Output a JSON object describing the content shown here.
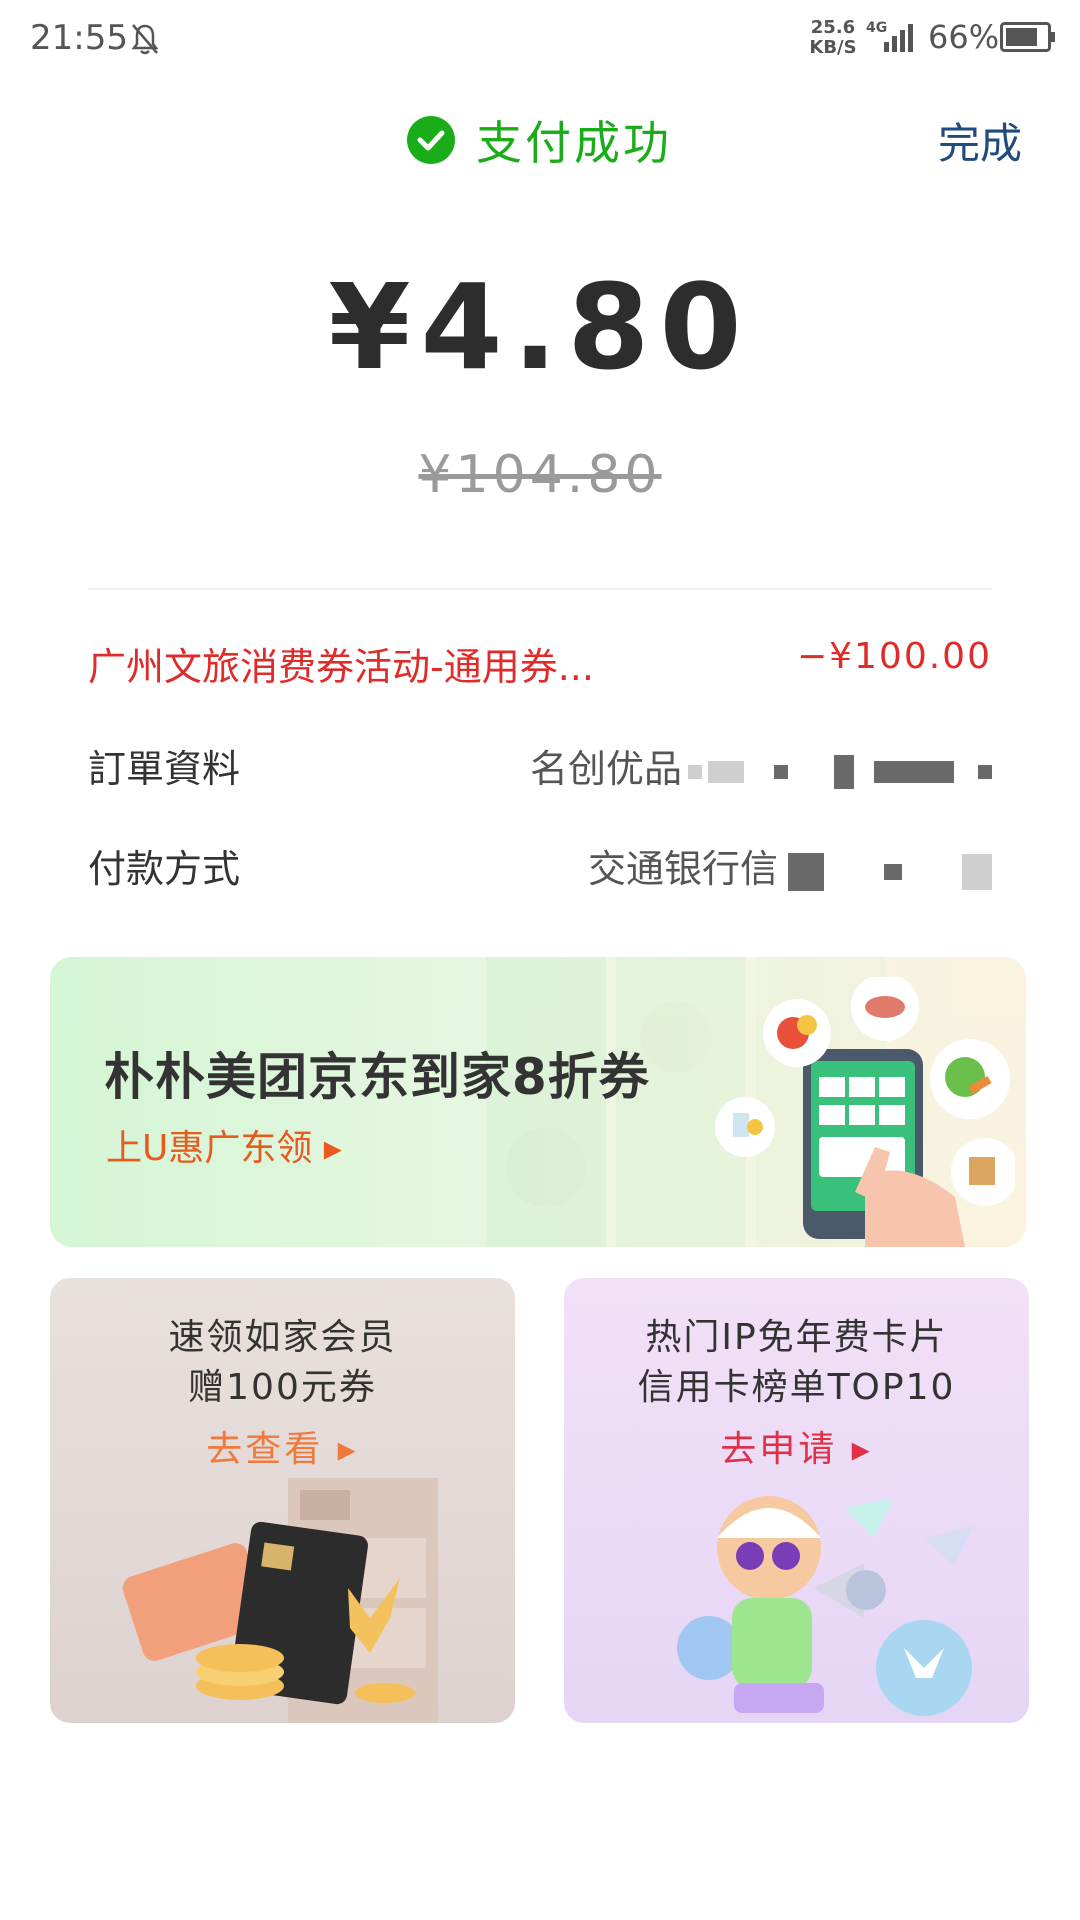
{
  "status_bar": {
    "time": "21:55",
    "speed_value": "25.6",
    "speed_unit": "KB/S",
    "network": "4G",
    "battery": "66%"
  },
  "header": {
    "status_title": "支付成功",
    "done_label": "完成"
  },
  "amount": {
    "paid": "¥4.80",
    "original": "¥104.80"
  },
  "details": {
    "coupon_label": "广州文旅消费券活动-通用券...",
    "coupon_value": "−¥100.00",
    "order_label": "訂單資料",
    "order_value": "名创优品",
    "payment_label": "付款方式",
    "payment_value": "交通银行信"
  },
  "banner": {
    "title": "朴朴美团京东到家8折券",
    "subtitle": "上U惠广东领 ▸"
  },
  "cards": [
    {
      "line1": "速领如家会员",
      "line2": "赠100元券",
      "cta": "去查看 ▸"
    },
    {
      "line1": "热门IP免年费卡片",
      "line2": "信用卡榜单TOP10",
      "cta": "去申请 ▸"
    }
  ],
  "colors": {
    "success_green": "#1aad19",
    "done_blue": "#1f4c7d",
    "coupon_red": "#e02b2b",
    "banner_cta": "#e85a1f"
  }
}
